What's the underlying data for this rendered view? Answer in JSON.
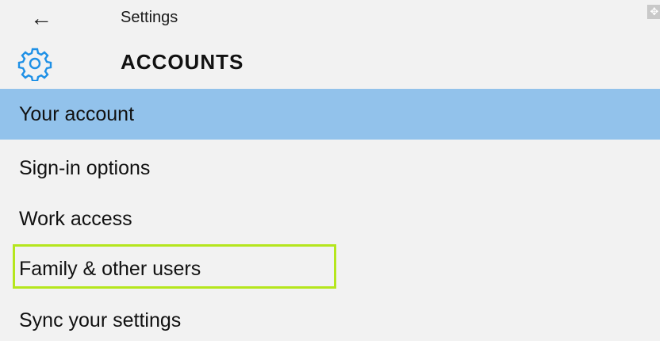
{
  "window": {
    "title": "Settings"
  },
  "header": {
    "section": "ACCOUNTS",
    "icon": "gear-icon"
  },
  "nav": {
    "selected_color": "#92c2eb",
    "items": [
      {
        "label": "Your account",
        "selected": true
      },
      {
        "label": "Sign-in options",
        "selected": false
      },
      {
        "label": "Work access",
        "selected": false
      },
      {
        "label": "Family & other users",
        "selected": false,
        "highlighted": true
      },
      {
        "label": "Sync your settings",
        "selected": false
      }
    ]
  },
  "colors": {
    "accent": "#1e90e6",
    "highlight_border": "#b5e61d",
    "background": "#f2f2f2"
  }
}
